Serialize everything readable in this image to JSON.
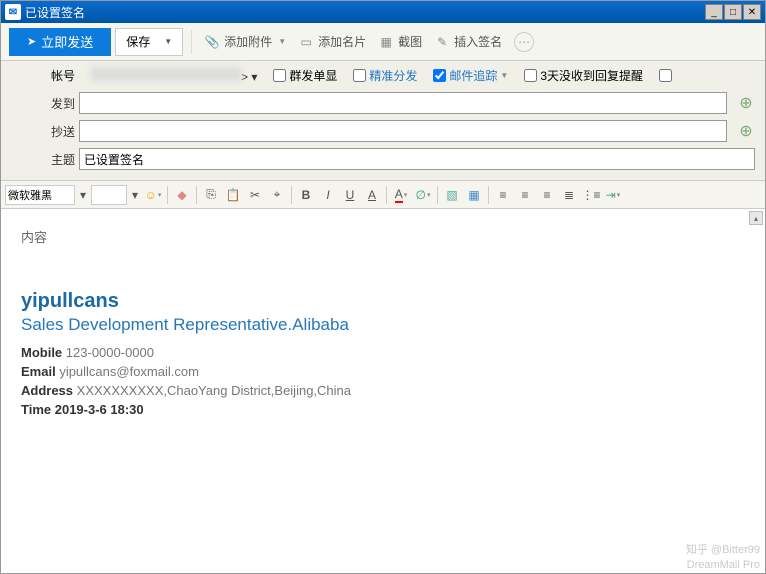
{
  "window": {
    "title": "已设置签名"
  },
  "toolbar": {
    "send": "立即发送",
    "save": "保存",
    "attach": "添加附件",
    "card": "添加名片",
    "screenshot": "截图",
    "signature": "插入签名"
  },
  "header": {
    "account_label": "帐号",
    "account_suffix": "> ▾",
    "opt_single": "群发单显",
    "opt_precise": "精准分发",
    "opt_track": "邮件追踪",
    "opt_remind": "3天没收到回复提醒",
    "to_label": "发到",
    "cc_label": "抄送",
    "subject_label": "主题",
    "subject_value": "已设置签名"
  },
  "format": {
    "font": "微软雅黑"
  },
  "body": {
    "content_label": "内容",
    "sig": {
      "name": "yipullcans",
      "title": "Sales Development Representative.Alibaba",
      "mobile_k": "Mobile",
      "mobile_v": "123-0000-0000",
      "email_k": "Email",
      "email_v": "yipullcans@foxmail.com",
      "address_k": "Address",
      "address_v": "XXXXXXXXXX,ChaoYang District,Beijing,China",
      "time_k": "Time",
      "time_v": "2019-3-6 18:30"
    }
  },
  "watermark": {
    "line1": "知乎 @Bitter99",
    "line2": "DreamMail Pro"
  }
}
